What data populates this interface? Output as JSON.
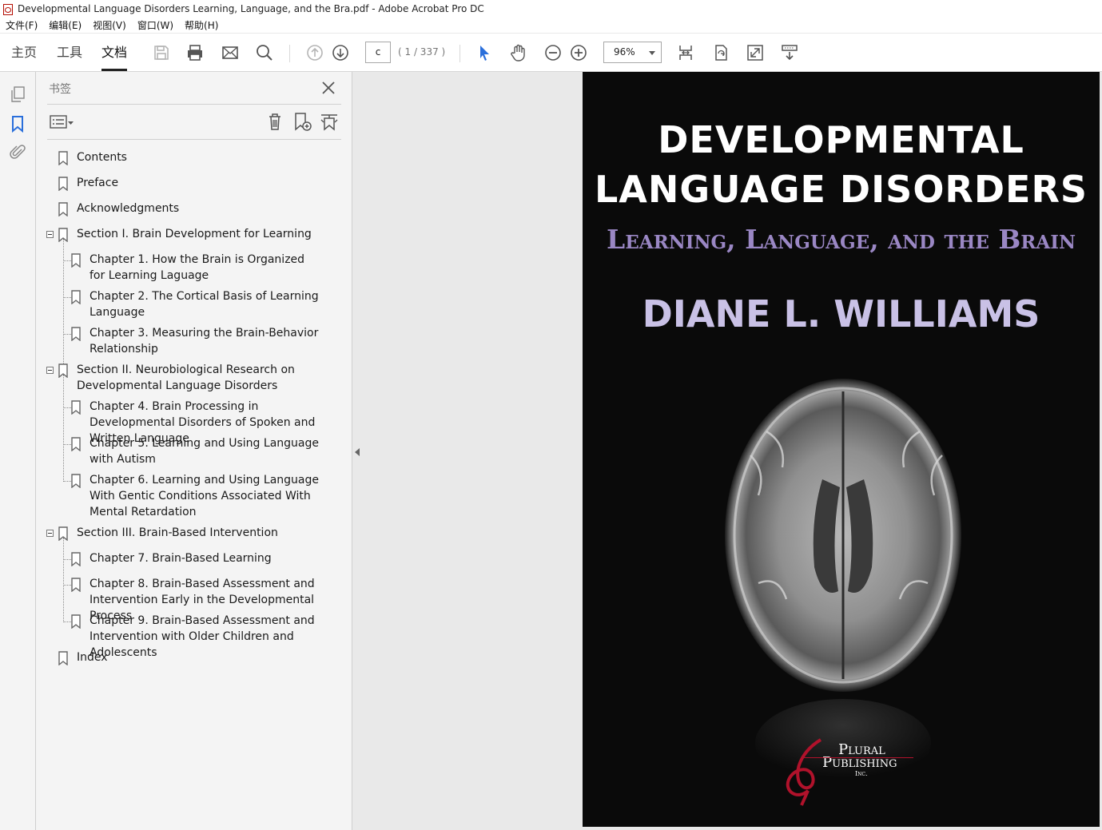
{
  "window": {
    "title": "Developmental Language Disorders Learning, Language, and the Bra.pdf - Adobe Acrobat Pro DC"
  },
  "menu": [
    "文件(F)",
    "编辑(E)",
    "视图(V)",
    "窗口(W)",
    "帮助(H)"
  ],
  "tabs": {
    "home": "主页",
    "tools": "工具",
    "document": "文档",
    "active": "document"
  },
  "toolbar": {
    "page_input": "c",
    "page_count": "( 1 / 337 )",
    "zoom": "96%"
  },
  "bookmarks_panel": {
    "title": "书签",
    "items": [
      {
        "label": "Contents",
        "level": 0
      },
      {
        "label": "Preface",
        "level": 0
      },
      {
        "label": "Acknowledgments",
        "level": 0
      },
      {
        "label": "Section I. Brain Development for Learning",
        "level": 0,
        "expanded": true
      },
      {
        "label": "Chapter 1. How the Brain is Organized for Learning Laguage",
        "level": 1
      },
      {
        "label": "Chapter 2. The Cortical Basis of Learning Language",
        "level": 1
      },
      {
        "label": "Chapter 3. Measuring the Brain-Behavior Relationship",
        "level": 1
      },
      {
        "label": "Section II. Neurobiological Research on Developmental Language Disorders",
        "level": 0,
        "expanded": true
      },
      {
        "label": "Chapter 4. Brain Processing in Developmental Disorders of Spoken and Written Language",
        "level": 1
      },
      {
        "label": "Chapter 5. Learning and Using Language with Autism",
        "level": 1
      },
      {
        "label": "Chapter 6. Learning and Using Language With Gentic Conditions Associated With Mental Retardation",
        "level": 1
      },
      {
        "label": "Section III. Brain-Based Intervention",
        "level": 0,
        "expanded": true
      },
      {
        "label": "Chapter 7. Brain-Based Learning",
        "level": 1
      },
      {
        "label": "Chapter 8. Brain-Based Assessment and Intervention Early in the Developmental Process",
        "level": 1
      },
      {
        "label": "Chapter 9. Brain-Based Assessment and Intervention with Older Children and Adolescents",
        "level": 1
      },
      {
        "label": "Index",
        "level": 0
      }
    ]
  },
  "cover": {
    "title_line1": "DEVELOPMENTAL",
    "title_line2": "LANGUAGE DISORDERS",
    "subtitle": "Learning, Language, and the Brain",
    "author": "DIANE L. WILLIAMS",
    "publisher_line1": "Plural",
    "publisher_line2": "Publishing",
    "publisher_line3": "Inc."
  },
  "colors": {
    "subtitle": "#9a87c4",
    "author": "#c9c1e6",
    "accent_blue": "#2a6fdb",
    "publisher_ribbon": "#b0122b"
  }
}
